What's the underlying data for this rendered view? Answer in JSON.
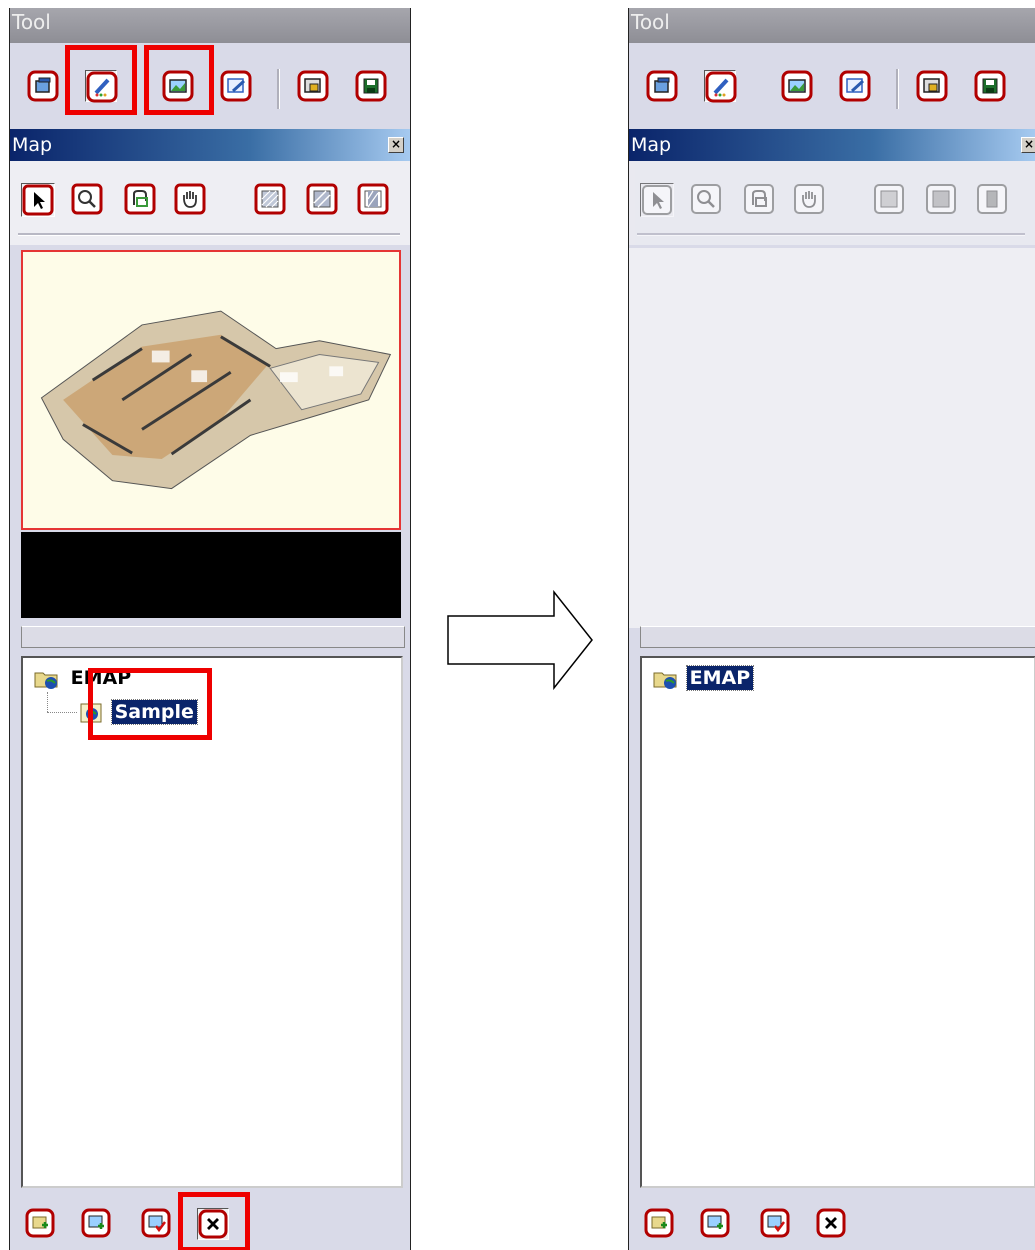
{
  "panels": {
    "left": {
      "tool_title": "Tool",
      "map_title": "Map",
      "close_glyph": "×",
      "tree": [
        {
          "label": "EMAP",
          "icon": "folder-globe-icon"
        },
        {
          "label": "Sample",
          "icon": "globe-icon",
          "selected": true
        }
      ]
    },
    "right": {
      "tool_title": "Tool",
      "map_title": "Map",
      "close_glyph": "×",
      "tree": [
        {
          "label": "EMAP",
          "icon": "folder-globe-icon",
          "selected": true
        }
      ]
    }
  },
  "toolbar_icons": [
    "window-icon",
    "edit-pencil-icon",
    "map-image-icon",
    "edit-note-icon",
    "lock-icon",
    "save-icon"
  ],
  "maptool_icons": [
    "pointer-icon",
    "zoom-in-icon",
    "zoom-out-icon",
    "hand-icon",
    "pattern1-icon",
    "pattern2-icon",
    "pattern3-icon"
  ],
  "bottom_icons": [
    "add-folder-icon",
    "add-map-icon",
    "check-map-icon",
    "delete-icon"
  ],
  "colors": {
    "highlight": "#ee0000",
    "selection": "#0a246a",
    "icon_border": "#b10000"
  }
}
